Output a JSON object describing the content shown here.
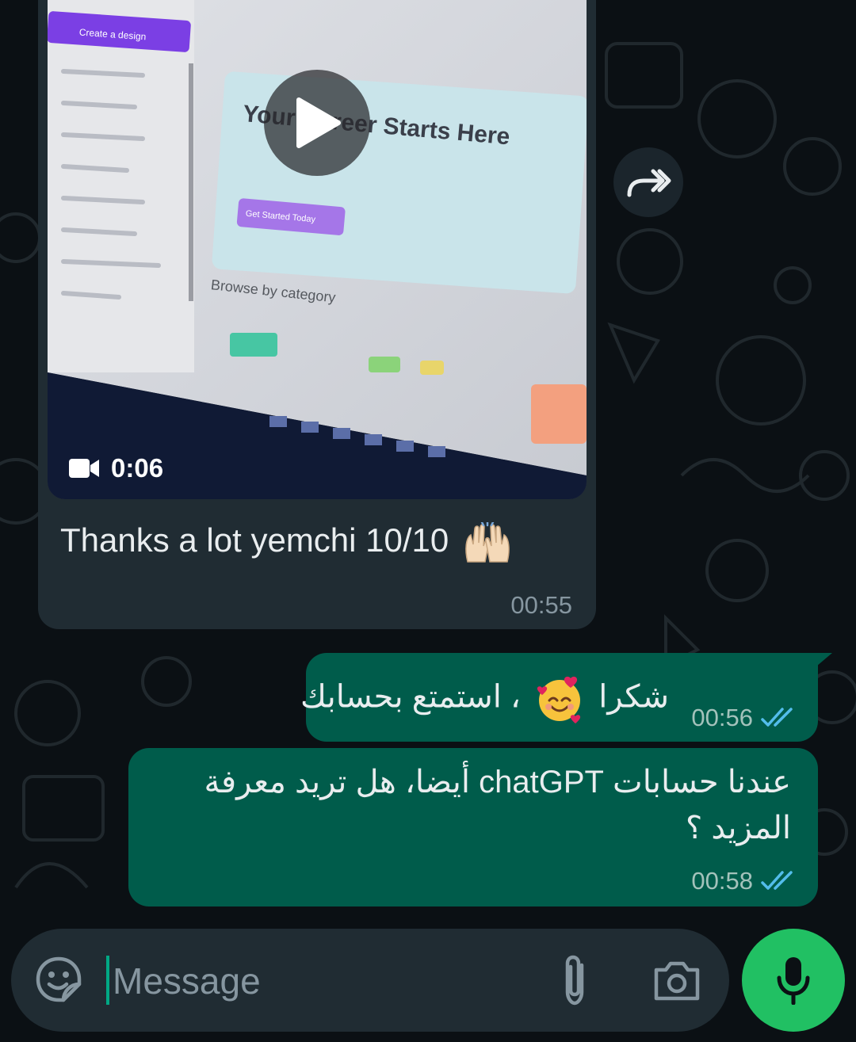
{
  "colors": {
    "background": "#0b1014",
    "incoming_bubble": "#202c33",
    "outgoing_bubble": "#005c4b",
    "read_ticks": "#53bdeb",
    "mic_button": "#21c063",
    "cursor": "#00a884"
  },
  "video_message": {
    "duration": "0:06",
    "caption": "Thanks a lot yemchi 10/10",
    "caption_emoji": "raising-hands",
    "time": "00:55",
    "thumbnail": {
      "sidebar_button": "Create a design",
      "hero_title": "Your Career Starts Here",
      "hero_button": "Get Started Today",
      "section_heading": "Browse by category"
    }
  },
  "forward_icon": "forward-icon",
  "outgoing_messages": [
    {
      "text_before_emoji": "شكرا",
      "emoji": "smiling-face-with-hearts",
      "text_after_emoji": "، استمتع بحسابك",
      "time": "00:56",
      "status": "read"
    },
    {
      "text": "عندنا حسابات chatGPT أيضا، هل تريد معرفة المزيد ؟",
      "time": "00:58",
      "status": "read"
    }
  ],
  "composer": {
    "placeholder": "Message",
    "icons": [
      "emoji-sticker-icon",
      "attach-icon",
      "camera-icon",
      "mic-icon"
    ]
  }
}
